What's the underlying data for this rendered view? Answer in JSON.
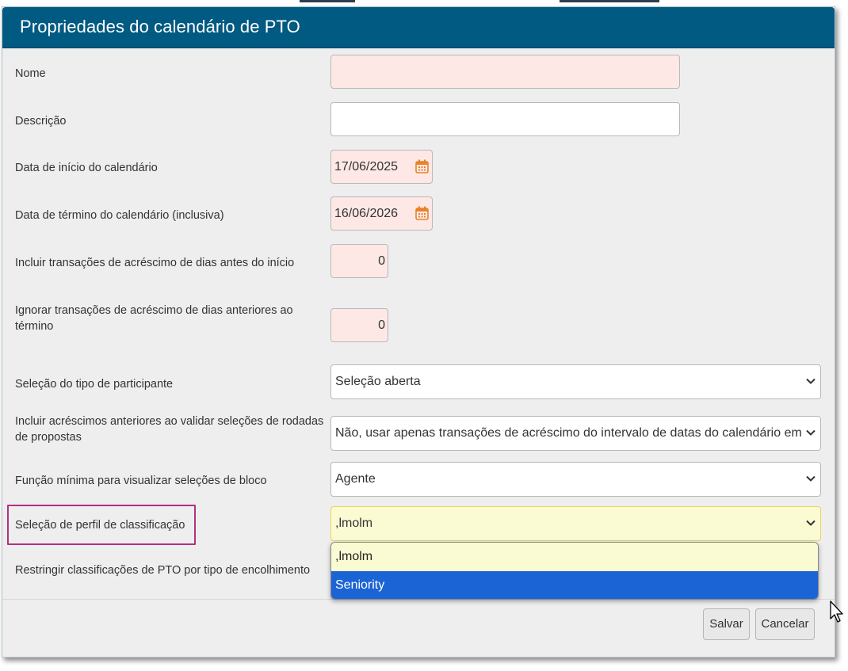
{
  "dialog": {
    "title": "Propriedades do calendário de PTO"
  },
  "fields": {
    "nome": {
      "label": "Nome",
      "value": ""
    },
    "descricao": {
      "label": "Descrição",
      "value": ""
    },
    "data_inicio": {
      "label": "Data de início do calendário",
      "value": "17/06/2025"
    },
    "data_termino": {
      "label": "Data de término do calendário (inclusiva)",
      "value": "16/06/2026"
    },
    "incluir_antes": {
      "label": "Incluir transações de acréscimo de dias antes do início",
      "value": "0"
    },
    "ignorar_anteriores": {
      "label": "Ignorar transações de acréscimo de dias anteriores ao término",
      "value": "0"
    },
    "tipo_participante": {
      "label": "Seleção do tipo de participante",
      "value": "Seleção aberta"
    },
    "incluir_acrescimos": {
      "label": "Incluir acréscimos anteriores ao validar seleções de rodadas de propostas",
      "value": "Não, usar apenas transações de acréscimo do intervalo de datas do calendário em"
    },
    "funcao_minima": {
      "label": "Função mínima para visualizar seleções de bloco",
      "value": "Agente"
    },
    "perfil_classificacao": {
      "label": "Seleção de perfil de classificação",
      "value": ",lmolm"
    },
    "restringir": {
      "label": "Restringir classificações de PTO por tipo de encolhimento"
    }
  },
  "dropdown": {
    "options": [
      ",lmolm",
      "Seniority"
    ],
    "selected_index": 1
  },
  "buttons": {
    "save": "Salvar",
    "cancel": "Cancelar"
  },
  "colors": {
    "header": "#005a82",
    "required_bg": "#fde8e5",
    "selected_option": "#1b64d6",
    "highlight": "#b0327f",
    "calendar_icon": "#e8832a"
  },
  "icons": {
    "calendar": "calendar-icon",
    "chevron": "chevron-down-icon",
    "cursor": "mouse-pointer-icon"
  }
}
